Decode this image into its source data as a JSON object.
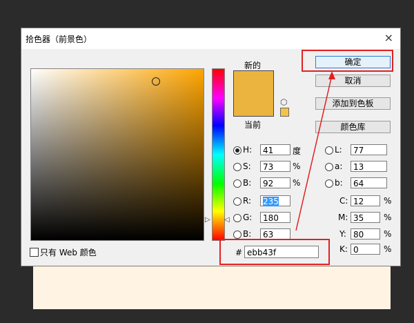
{
  "dialog": {
    "title": "拾色器（前景色）",
    "new_label": "新的",
    "current_label": "当前",
    "new_color": "#ebb43f",
    "current_color": "#ebb43f"
  },
  "buttons": {
    "ok": "确定",
    "cancel": "取消",
    "add_to_swatches": "添加到色板",
    "color_libraries": "颜色库"
  },
  "hsb": [
    {
      "label": "H:",
      "value": "41",
      "unit": "度",
      "checked": true
    },
    {
      "label": "S:",
      "value": "73",
      "unit": "%",
      "checked": false
    },
    {
      "label": "B:",
      "value": "92",
      "unit": "%",
      "checked": false
    }
  ],
  "rgb": [
    {
      "label": "R:",
      "value": "235"
    },
    {
      "label": "G:",
      "value": "180"
    },
    {
      "label": "B:",
      "value": "63"
    }
  ],
  "lab": [
    {
      "label": "L:",
      "value": "77"
    },
    {
      "label": "a:",
      "value": "13"
    },
    {
      "label": "b:",
      "value": "64"
    }
  ],
  "cmyk": [
    {
      "label": "C:",
      "value": "12",
      "unit": "%"
    },
    {
      "label": "M:",
      "value": "35",
      "unit": "%"
    },
    {
      "label": "Y:",
      "value": "80",
      "unit": "%"
    },
    {
      "label": "K:",
      "value": "0",
      "unit": "%"
    }
  ],
  "hex": {
    "label": "#",
    "value": "ebb43f"
  },
  "web_only_label": "只有 Web 颜色",
  "icons": {
    "close": "×",
    "cube": "⬡"
  },
  "annotation_color": "#e02020"
}
